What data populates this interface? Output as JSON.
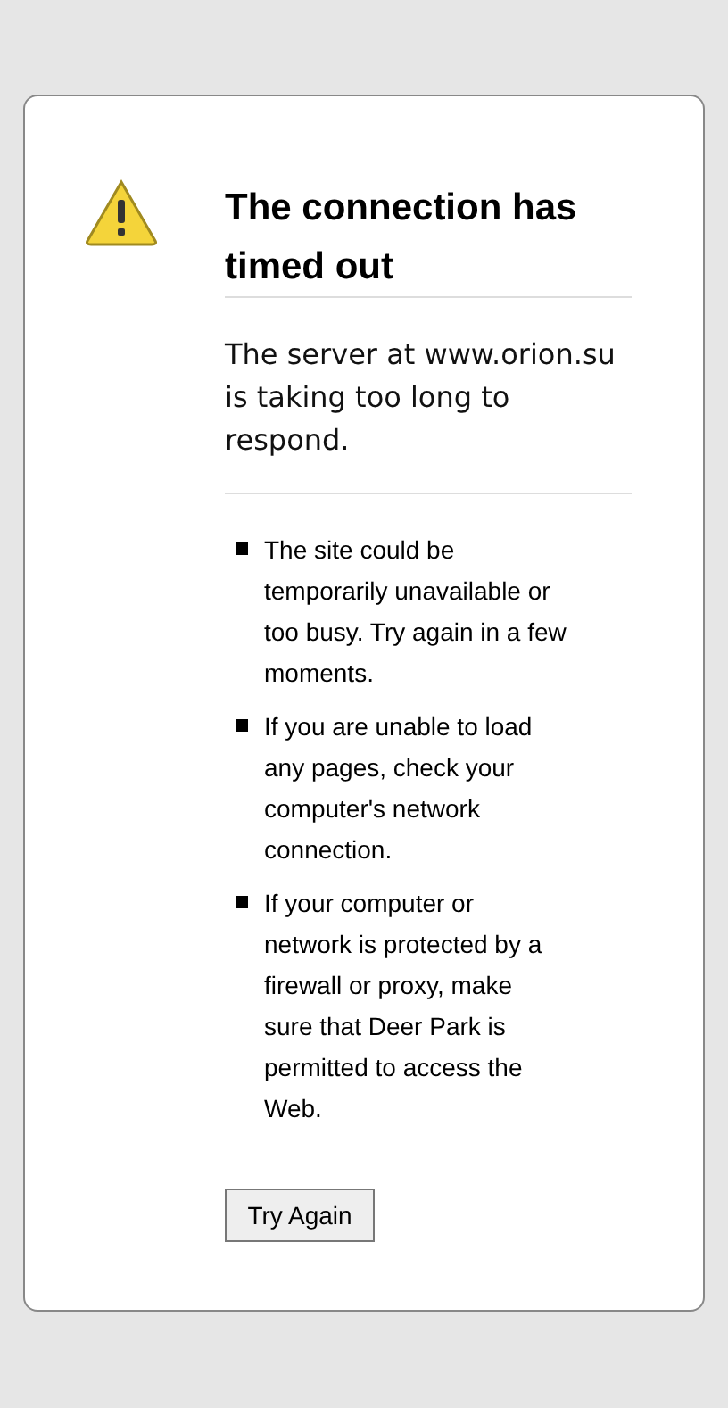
{
  "title": "The connection has timed out",
  "message": "The server at www.orion.su is taking too long to respond.",
  "suggestions": [
    "The site could be temporarily unavailable or too busy. Try again in a few moments.",
    "If you are unable to load any pages, check your computer's network connection.",
    "If your computer or network is protected by a firewall or proxy, make sure that Deer Park is permitted to access the Web."
  ],
  "button": "Try Again"
}
